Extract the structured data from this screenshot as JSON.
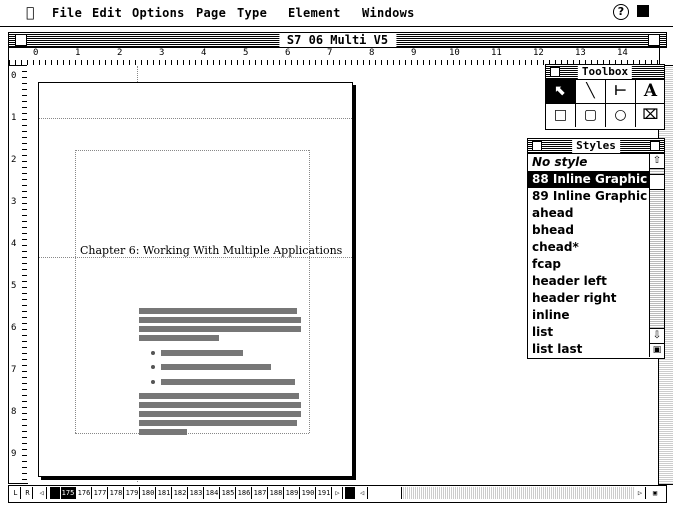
{
  "menubar": {
    "apple_icon": "apple-icon",
    "items": [
      "File",
      "Edit",
      "Options",
      "Page",
      "Type",
      "Element",
      "Windows"
    ]
  },
  "document": {
    "title": "S7 06 Multi V5",
    "ruler_numbers": [
      "0",
      "1",
      "2",
      "3",
      "4",
      "5",
      "6",
      "7",
      "8",
      "9",
      "10",
      "11",
      "12",
      "13",
      "14"
    ],
    "vruler_numbers": [
      "0",
      "1",
      "2",
      "3",
      "4",
      "5",
      "6",
      "7",
      "8",
      "9"
    ],
    "heading": "Chapter 6: Working With Multiple Applications"
  },
  "pagebar": {
    "left_master": "L",
    "right_master": "R",
    "pages": [
      "175",
      "176",
      "177",
      "178",
      "179",
      "180",
      "181",
      "182",
      "183",
      "184",
      "185",
      "186",
      "187",
      "188",
      "189",
      "190",
      "191"
    ]
  },
  "toolbox": {
    "title": "Toolbox",
    "tools": [
      "arrow-tool",
      "diagonal-line-tool",
      "perpendicular-line-tool",
      "text-tool",
      "rectangle-tool",
      "rounded-rectangle-tool",
      "oval-tool",
      "crop-tool"
    ],
    "text_tool_glyph": "A"
  },
  "styles": {
    "title": "Styles",
    "items": [
      "No style",
      "88 Inline Graphic",
      "89 Inline Graphic",
      "ahead",
      "bhead",
      "chead*",
      "fcap",
      "header left",
      "header right",
      "inline",
      "list",
      "list last"
    ],
    "selected": "88 Inline Graphic"
  }
}
